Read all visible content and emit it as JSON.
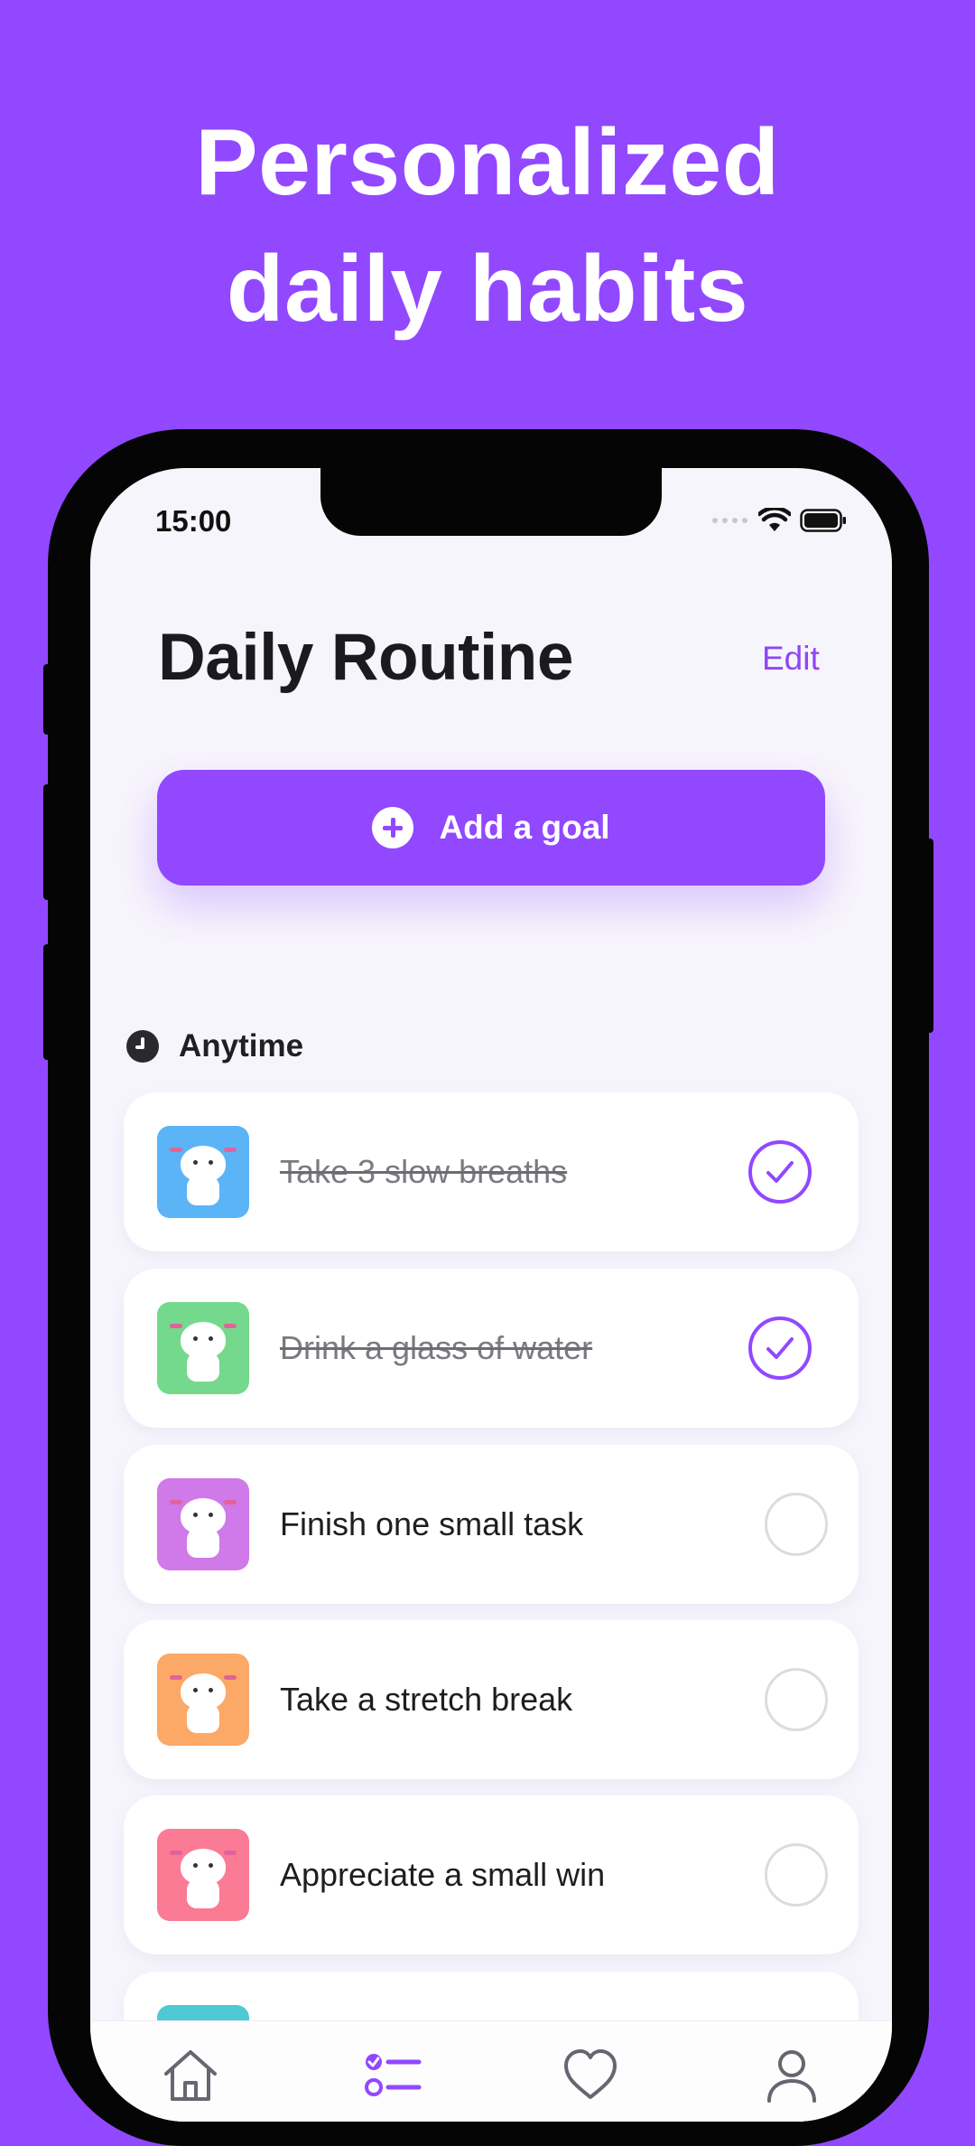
{
  "headline": {
    "line1": "Personalized",
    "line2": "daily habits"
  },
  "status_bar": {
    "time": "15:00",
    "icons": [
      "signal-dots-icon",
      "wifi-icon",
      "battery-icon"
    ]
  },
  "header": {
    "title": "Daily Routine",
    "edit_label": "Edit"
  },
  "add_goal": {
    "label": "Add a goal",
    "icon": "plus-circle-icon"
  },
  "section": {
    "title": "Anytime",
    "icon": "clock-icon"
  },
  "tasks": [
    {
      "label": "Take 3 slow breaths",
      "done": true,
      "thumb_color": "#5BB4F6"
    },
    {
      "label": "Drink a glass of water",
      "done": true,
      "thumb_color": "#74D98C"
    },
    {
      "label": "Finish one small task",
      "done": false,
      "thumb_color": "#D079E8"
    },
    {
      "label": "Take a stretch break",
      "done": false,
      "thumb_color": "#FCA867"
    },
    {
      "label": "Appreciate a small win",
      "done": false,
      "thumb_color": "#FB7A94"
    }
  ],
  "tabbar": {
    "items": [
      {
        "name": "home",
        "icon": "home-icon",
        "active": false
      },
      {
        "name": "routine",
        "icon": "checklist-icon",
        "active": true
      },
      {
        "name": "favorites",
        "icon": "heart-icon",
        "active": false
      },
      {
        "name": "profile",
        "icon": "person-icon",
        "active": false
      }
    ]
  },
  "colors": {
    "brand": "#9148FF",
    "background": "#F7F5FC",
    "accent_text": "#8E45F7"
  }
}
